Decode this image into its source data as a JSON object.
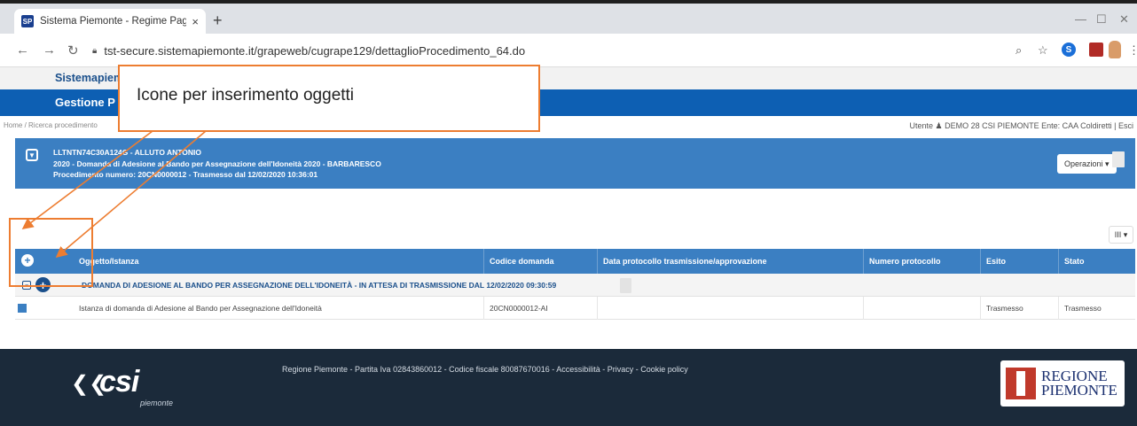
{
  "browser": {
    "tab_title": "Sistema Piemonte - Regime Paga",
    "tab_close": "×",
    "new_tab": "+",
    "favicon_text": "SP",
    "url": "tst-secure.sistemapiemonte.it/grapeweb/cugrape129/dettaglioProcedimento_64.do",
    "icons": [
      "back-icon",
      "forward-icon",
      "reload-icon",
      "lock-icon",
      "zoom-icon",
      "star-icon",
      "skype-icon",
      "pdf-icon",
      "profile-icon",
      "menu-icon"
    ]
  },
  "site": {
    "brand": "Sistemapiem",
    "app_title": "Gestione P",
    "breadcrumbs": "Home / Ricerca procedimento",
    "userline": "Utente ♟ DEMO 28 CSI PIEMONTE  Ente: CAA Coldiretti | Esci"
  },
  "procedure": {
    "line1": "LLTNTN74C30A124G - ALLUTO ANTONIO",
    "line2": "2020 - Domanda di Adesione al Bando per Assegnazione dell'Idoneità 2020 - BARBARESCO",
    "line3": "Procedimento numero: 20CN0000012 - Trasmesso dal 12/02/2020 10:36:01",
    "operations_button": "Operazioni ▾"
  },
  "table": {
    "column_selector": "III ▾",
    "headers": [
      "Oggetto/Istanza",
      "Codice domanda",
      "Data protocollo trasmissione/approvazione",
      "Numero protocollo",
      "Esito",
      "Stato"
    ],
    "group_title": "DOMANDA DI ADESIONE AL BANDO PER ASSEGNAZIONE DELL'IDONEITÀ - IN ATTESA DI TRASMISSIONE DAL 12/02/2020 09:30:59",
    "rows": [
      {
        "oggetto": "Istanza di domanda di Adesione al Bando per Assegnazione dell'Idoneità",
        "codice": "20CN0000012-AI",
        "data_protocollo": "",
        "numero_protocollo": "",
        "esito": "Trasmesso",
        "stato": "Trasmesso"
      }
    ]
  },
  "footer": {
    "logo": "csi",
    "logo_sub": "piemonte",
    "text": "Regione Piemonte - Partita Iva 02843860012 - Codice fiscale 80087670016 - Accessibilità - Privacy - Cookie policy",
    "region_logo_line1": "REGIONE",
    "region_logo_line2": "PIEMONTE"
  },
  "annotation": {
    "callout_text": "Icone per inserimento oggetti",
    "color": "#ED7D31"
  },
  "colors": {
    "header_blue": "#0D5FB3",
    "panel_blue": "#3B7FC2",
    "link_blue": "#1A4F8B",
    "footer_dark": "#1B2A3A"
  }
}
